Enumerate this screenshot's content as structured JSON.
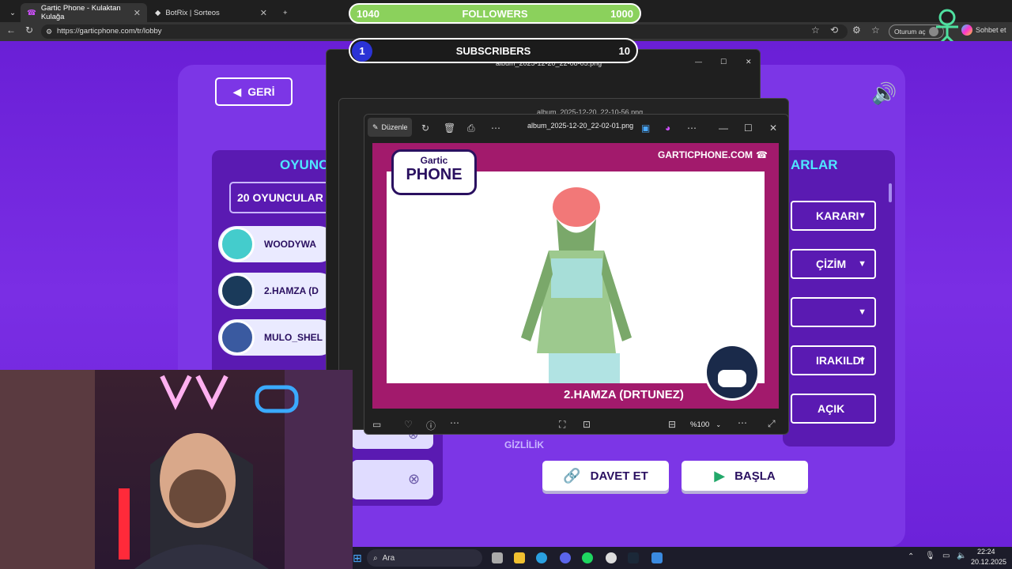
{
  "browser": {
    "tabs": [
      {
        "title": "Gartic Phone - Kulaktan Kulağa",
        "active": true
      },
      {
        "title": "BotRix | Sorteos",
        "active": false
      }
    ],
    "url": "https://garticphone.com/tr/lobby",
    "profile_label": "Oturum aç",
    "chat_label": "Sohbet et"
  },
  "overlay": {
    "followers": {
      "left": "1040",
      "label": "FOLLOWERS",
      "right": "1000"
    },
    "subscribers": {
      "left": "1",
      "label": "SUBSCRIBERS",
      "right": "10"
    }
  },
  "lobby": {
    "back_label": "GERİ",
    "players_title": "OYUNC",
    "players_count": "20 OYUNCULAR",
    "players": [
      {
        "name": "WOODYWA"
      },
      {
        "name": "2.HAMZA (D"
      },
      {
        "name": "MULO_SHEL"
      }
    ],
    "settings_title": "ARLAR",
    "settings": [
      {
        "label": "KARARI"
      },
      {
        "label": "ÇİZİM"
      },
      {
        "label": ""
      },
      {
        "label": "IRAKILDI"
      },
      {
        "label": "AÇIK"
      }
    ],
    "privacy_label": "GİZLİLİK",
    "invite_label": "DAVET ET",
    "start_label": "BAŞLA"
  },
  "photo_viewer": {
    "back_filename": "album_2025-12-20_22-08-05.png",
    "mid_filename": "album_2025-12-20_22-10-56.png",
    "filename": "album_2025-12-20_22-02-01.png",
    "edit_label": "Düzenle",
    "zoom": "%100",
    "site_label": "GARTICPHONE.COM",
    "logo_top": "Gartic",
    "logo_bottom": "PHONE",
    "author": "2.HAMZA (DRTUNEZ)"
  },
  "taskbar": {
    "search_label": "Ara",
    "time": "22:24",
    "date": "20.12.2025"
  }
}
